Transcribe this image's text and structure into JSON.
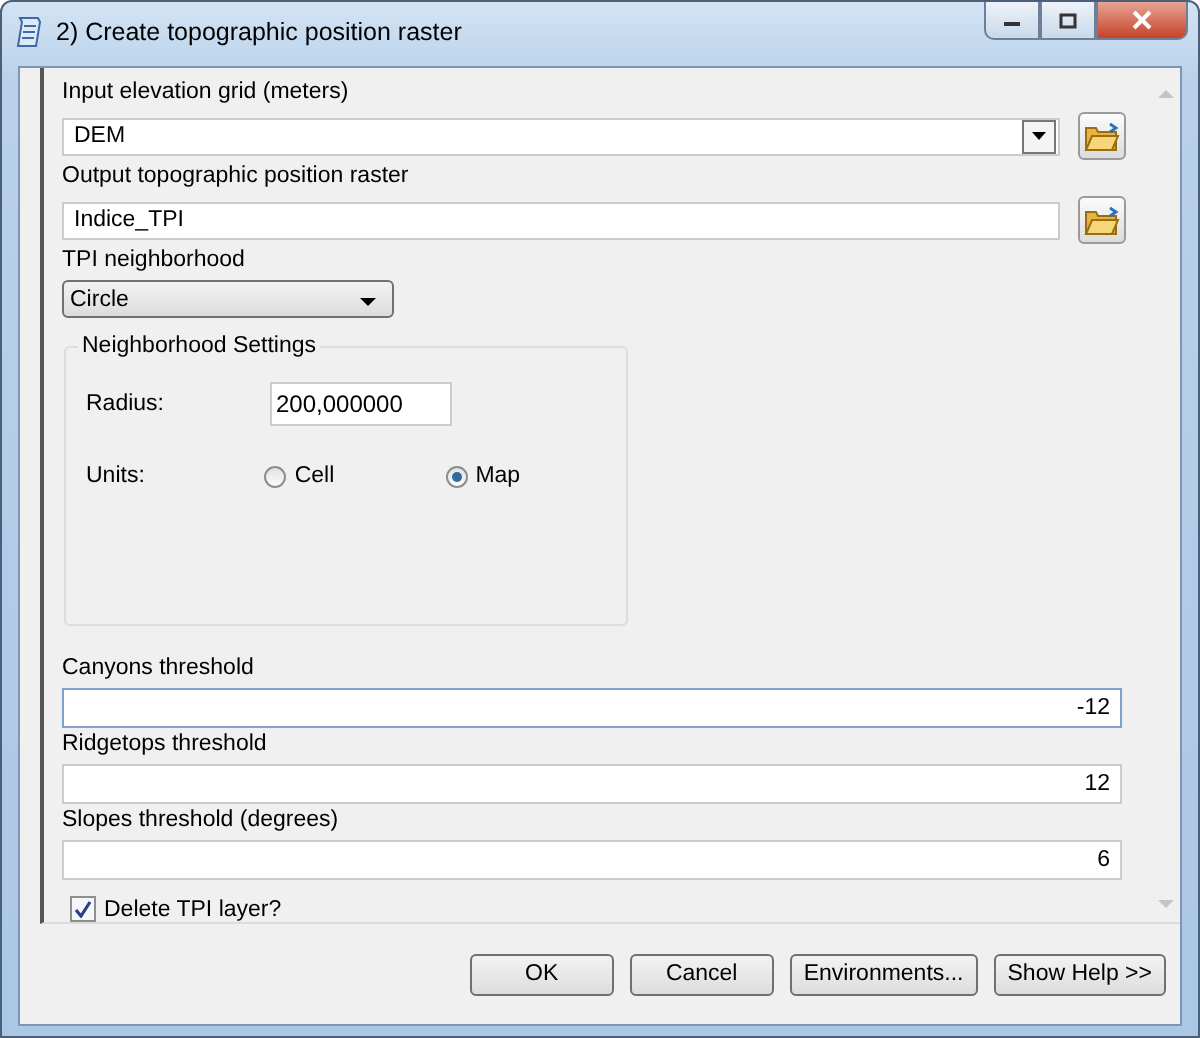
{
  "window": {
    "title": "2) Create topographic position raster"
  },
  "params": [
    {
      "kind": "combo",
      "label": "Input elevation grid (meters)",
      "value": "DEM"
    },
    {
      "kind": "text",
      "label": "Output topographic position raster",
      "value": "Indice_TPI"
    },
    {
      "kind": "dropdown",
      "label": "TPI neighborhood",
      "value": "Circle"
    },
    {
      "kind": "group",
      "title": "Neighborhood Settings",
      "radius": {
        "label": "Radius:",
        "value": "200,000000"
      },
      "units": {
        "label": "Units:",
        "options": [
          {
            "label": "Cell",
            "selected": false
          },
          {
            "label": "Map",
            "selected": true
          }
        ]
      }
    },
    {
      "kind": "number",
      "label": "Canyons threshold",
      "value": "-12",
      "focused": true
    },
    {
      "kind": "number",
      "label": "Ridgetops threshold",
      "value": "12",
      "focused": false
    },
    {
      "kind": "number",
      "label": "Slopes threshold (degrees)",
      "value": "6",
      "focused": false
    },
    {
      "kind": "checkbox",
      "label": "Delete TPI layer?",
      "checked": true
    }
  ],
  "buttons": [
    "OK",
    "Cancel",
    "Environments...",
    "Show Help >>"
  ]
}
